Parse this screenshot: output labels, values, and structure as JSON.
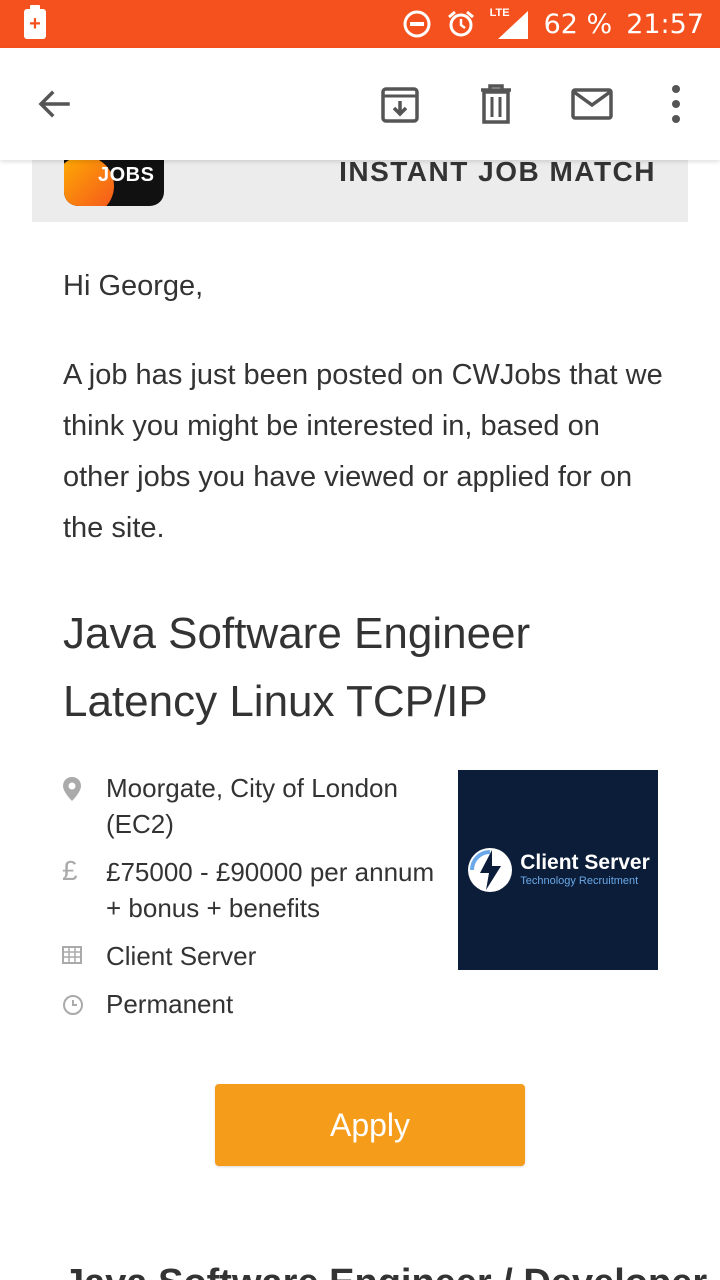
{
  "status_bar": {
    "battery": "62 %",
    "time": "21:57",
    "network": "LTE",
    "bg_color": "#f4511e",
    "icons": [
      "battery-saver-icon",
      "do-not-disturb-icon",
      "alarm-icon",
      "signal-icon"
    ]
  },
  "toolbar": {
    "icons": [
      "back-arrow-icon",
      "archive-icon",
      "delete-icon",
      "mail-icon",
      "more-vert-icon"
    ]
  },
  "banner": {
    "logo_text": "JOBS",
    "title": "INSTANT JOB MATCH"
  },
  "email": {
    "greeting": "Hi George,",
    "intro": "A job has just been posted on CWJobs that we think you might be interested in, based on other jobs you have viewed or applied for on the site.",
    "job_title": "Java Software Engineer Latency Linux TCP/IP",
    "details": {
      "location": "Moorgate, City of London (EC2)",
      "salary": "£75000 - £90000 per annum + bonus + benefits",
      "company": "Client Server",
      "job_type": "Permanent"
    },
    "company_logo": {
      "name": "Client Server",
      "tagline": "Technology Recruitment",
      "bg_color": "#0b1d38"
    },
    "apply_label": "Apply",
    "apply_color": "#f59c1a",
    "next_job_peek": "Java Software Engineer / Developer"
  }
}
